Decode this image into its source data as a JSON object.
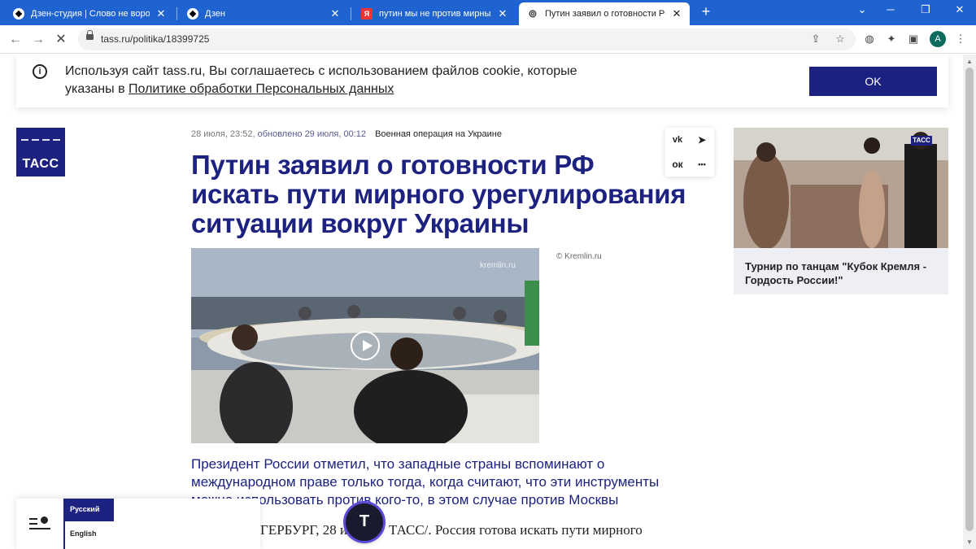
{
  "browser": {
    "tabs": [
      {
        "title": "Дзен-студия | Слово не воробе",
        "icon": "dzen-icon"
      },
      {
        "title": "Дзен",
        "icon": "dzen-icon"
      },
      {
        "title": "путин мы не против мирных п",
        "icon": "yandex-icon"
      },
      {
        "title": "Путин заявил о готовности РФ",
        "icon": "tass-icon",
        "active": true
      }
    ],
    "new_tab_label": "+",
    "url": "tass.ru/politika/18399725",
    "profile_initial": "A"
  },
  "cookie": {
    "text_part1": "Используя сайт tass.ru, Вы соглашаетесь с использованием файлов cookie, которые указаны в ",
    "link_text": "Политике обработки Персональных данных",
    "ok_label": "OK"
  },
  "logo": {
    "text": "ТАСС"
  },
  "article": {
    "date": "28 июля, 23:52,",
    "updated": "обновлено 29 июля, 00:12",
    "rubric": "Военная операция на Украине",
    "title": "Путин заявил о готовности РФ искать пути мирного урегулирования ситуации вокруг Украины",
    "photo_credit": "© Kremlin.ru",
    "photo_watermark": "kremlin.ru",
    "lead": "Президент России отметил, что западные страны вспоминают о международном праве только тогда, когда считают, что эти инструменты можно использовать против кого-то, в этом случае против Москвы",
    "body_start": "ГЕРБУРГ, 28 ию",
    "body_mid": "ТАСС/. Россия готова искать пути мирного"
  },
  "share": {
    "vk": "vk",
    "tg": "➤",
    "ok": "ок",
    "more": "•••"
  },
  "sidebar": {
    "card_caption": "Турнир по танцам \"Кубок Кремля - Гордость России!\"",
    "card_badge": "ТАСС"
  },
  "langmenu": {
    "ru": "Русский",
    "en": "English"
  },
  "fab": {
    "letter": "T"
  },
  "colors": {
    "brand": "#1d2281",
    "chrome": "#1e63cf"
  }
}
